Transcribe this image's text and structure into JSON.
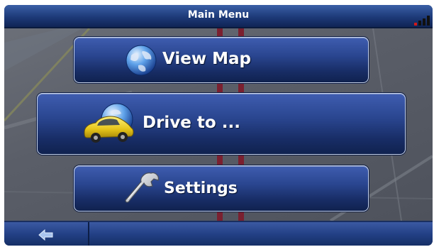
{
  "window": {
    "title": "Main Menu"
  },
  "status": {
    "signal_icon": "signal-strength-icon"
  },
  "menu": {
    "items": [
      {
        "label": "View Map",
        "icon": "globe-icon"
      },
      {
        "label": "Drive to ...",
        "icon": "car-icon"
      },
      {
        "label": "Settings",
        "icon": "wrench-icon"
      }
    ]
  },
  "bottom": {
    "back_icon": "back-arrow-icon"
  },
  "colors": {
    "button_top": "#3f5db0",
    "button_bottom": "#10224f",
    "bar_top": "#3a5fa6",
    "signal_low": "#d21818"
  }
}
